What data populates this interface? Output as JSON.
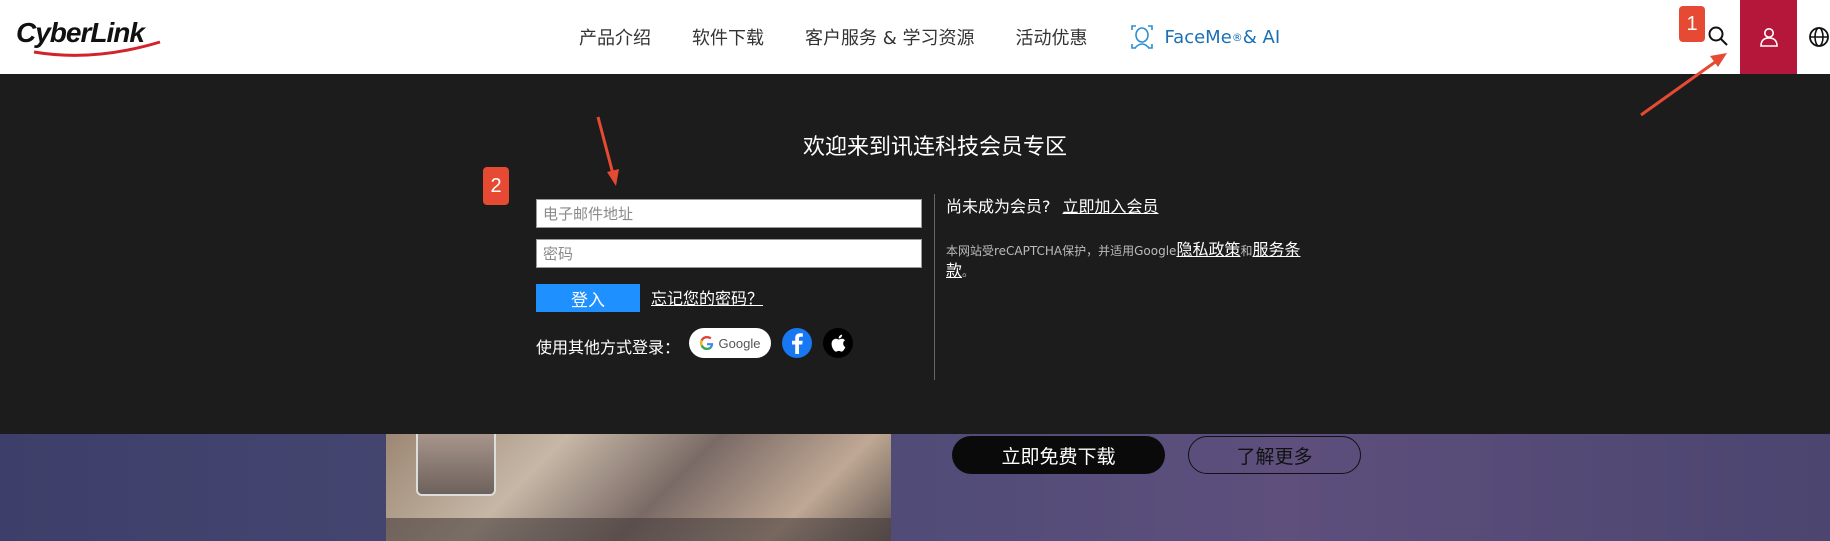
{
  "brand": {
    "logo_text": "CyberLink"
  },
  "nav": {
    "items": [
      {
        "label": "产品介绍"
      },
      {
        "label": "软件下载"
      },
      {
        "label": "客户服务 & 学习资源"
      },
      {
        "label": "活动优惠"
      }
    ],
    "faceme": {
      "label": "FaceMe",
      "sup": "®",
      "suffix": "& AI"
    }
  },
  "member_panel": {
    "title": "欢迎来到讯连科技会员专区",
    "email": {
      "placeholder": "电子邮件地址",
      "value": ""
    },
    "password": {
      "placeholder": "密码",
      "value": ""
    },
    "login_label": "登入",
    "forgot_label": "忘记您的密码？",
    "social_label": "使用其他方式登录：",
    "google_label": "Google",
    "join_prefix": "尚未成为会员?",
    "join_link": "立即加入会员",
    "recaptcha": {
      "prefix": "本网站受reCAPTCHA保护，并适用Google",
      "privacy": "隐私政策",
      "and": "和",
      "terms": "服务条款",
      "suffix": "。"
    }
  },
  "hero": {
    "download_label": "立即免费下载",
    "learn_label": "了解更多"
  },
  "annotations": [
    {
      "label": "1"
    },
    {
      "label": "2"
    }
  ],
  "colors": {
    "accent_red": "#b5173a",
    "panel_bg": "#1c1c1c",
    "login_blue": "#1e90ff",
    "annotation": "#e64a33",
    "faceme_blue": "#1b6fb5"
  },
  "icons": {
    "search": "search-icon",
    "user": "user-icon",
    "globe": "globe-icon",
    "faceme": "face-scan-icon",
    "facebook": "facebook-icon",
    "apple": "apple-icon",
    "google": "google-g-icon"
  }
}
